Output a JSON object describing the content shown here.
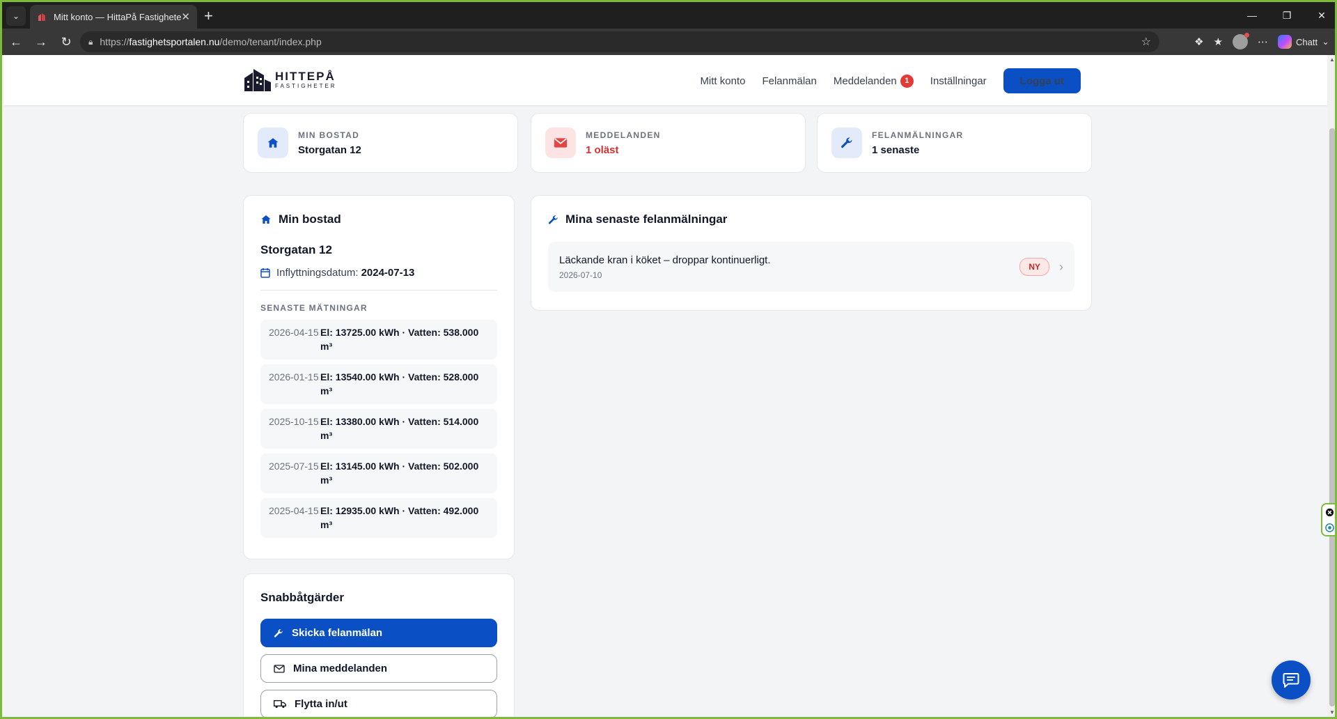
{
  "browser": {
    "tab_title": "Mitt konto — HittaPå Fastigheter",
    "url_prefix": "https://",
    "url_host": "fastighetsportalen.nu",
    "url_path": "/demo/tenant/index.php",
    "copilot_label": "Chatt"
  },
  "brand": {
    "name": "HITTEPÅ",
    "subtitle": "FASTIGHETER"
  },
  "nav": {
    "items": [
      {
        "label": "Mitt konto"
      },
      {
        "label": "Felanmälan"
      },
      {
        "label": "Meddelanden",
        "badge": "1"
      },
      {
        "label": "Inställningar"
      }
    ],
    "logout_label": "Logga ut"
  },
  "stats": [
    {
      "label": "MIN BOSTAD",
      "value": "Storgatan 12",
      "icon": "home-icon"
    },
    {
      "label": "MEDDELANDEN",
      "value": "1 oläst",
      "icon": "mail-icon"
    },
    {
      "label": "FELANMÄLNINGAR",
      "value": "1 senaste",
      "icon": "wrench-icon"
    }
  ],
  "home": {
    "title": "Min bostad",
    "address": "Storgatan 12",
    "move_in_label": "Inflyttningsdatum:",
    "move_in_date": "2024-07-13",
    "readings_label": "SENASTE MÄTNINGAR",
    "readings": [
      {
        "date": "2026-04-15",
        "value": "El: 13725.00 kWh · Vatten: 538.000 m³"
      },
      {
        "date": "2026-01-15",
        "value": "El: 13540.00 kWh · Vatten: 528.000 m³"
      },
      {
        "date": "2025-10-15",
        "value": "El: 13380.00 kWh · Vatten: 514.000 m³"
      },
      {
        "date": "2025-07-15",
        "value": "El: 13145.00 kWh · Vatten: 502.000 m³"
      },
      {
        "date": "2025-04-15",
        "value": "El: 12935.00 kWh · Vatten: 492.000 m³"
      }
    ]
  },
  "quick": {
    "title": "Snabbåtgärder",
    "buttons": [
      {
        "label": "Skicka felanmälan",
        "icon": "wrench-icon"
      },
      {
        "label": "Mina meddelanden",
        "icon": "mail-icon"
      },
      {
        "label": "Flytta in/ut",
        "icon": "truck-icon"
      }
    ]
  },
  "faults": {
    "title": "Mina senaste felanmälningar",
    "items": [
      {
        "description": "Läckande kran i köket – droppar kontinuerligt.",
        "date": "2026-07-10",
        "status": "NY"
      }
    ]
  },
  "colors": {
    "primary": "#0b4fc4",
    "danger": "#d32f2f",
    "frame_accent": "#7dbb3a"
  }
}
